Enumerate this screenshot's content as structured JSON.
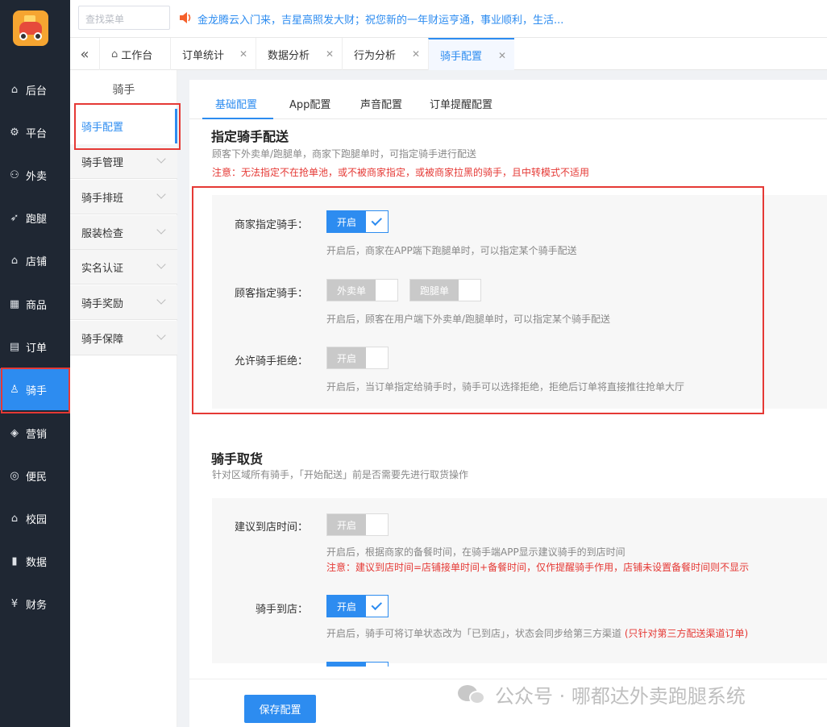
{
  "leftnav": {
    "items": [
      {
        "label": "后台",
        "icon": "⌂"
      },
      {
        "label": "平台",
        "icon": "⚙"
      },
      {
        "label": "外卖",
        "icon": "⚇"
      },
      {
        "label": "跑腿",
        "icon": "➶"
      },
      {
        "label": "店铺",
        "icon": "⌂"
      },
      {
        "label": "商品",
        "icon": "▦"
      },
      {
        "label": "订单",
        "icon": "▤"
      },
      {
        "label": "骑手",
        "icon": "♙"
      },
      {
        "label": "营销",
        "icon": "◈"
      },
      {
        "label": "便民",
        "icon": "◎"
      },
      {
        "label": "校园",
        "icon": "⌂"
      },
      {
        "label": "数据",
        "icon": "▮"
      },
      {
        "label": "财务",
        "icon": "¥"
      }
    ]
  },
  "topbar": {
    "search_placeholder": "查找菜单",
    "notice": "金龙腾云入门来，吉星高照发大财；祝您新的一年财运亨通，事业顺利，生活..."
  },
  "tabs": {
    "items": [
      {
        "label": "工作台"
      },
      {
        "label": "订单统计"
      },
      {
        "label": "数据分析"
      },
      {
        "label": "行为分析"
      },
      {
        "label": "骑手配置"
      }
    ]
  },
  "subside": {
    "title": "骑手",
    "items": [
      {
        "label": "骑手配置"
      },
      {
        "label": "骑手管理"
      },
      {
        "label": "骑手排班"
      },
      {
        "label": "服装检查"
      },
      {
        "label": "实名认证"
      },
      {
        "label": "骑手奖励"
      },
      {
        "label": "骑手保障"
      }
    ]
  },
  "content_tabs": [
    "基础配置",
    "App配置",
    "声音配置",
    "订单提醒配置"
  ],
  "section1": {
    "title": "指定骑手配送",
    "desc": "顾客下外卖单/跑腿单，商家下跑腿单时，可指定骑手进行配送",
    "warn": "注意：无法指定不在抢单池，或不被商家指定，或被商家拉黑的骑手，且中转模式不适用",
    "rows": [
      {
        "label": "商家指定骑手：",
        "toggle_label": "开启",
        "hint": "开启后，商家在APP端下跑腿单时，可以指定某个骑手配送"
      },
      {
        "label": "顾客指定骑手：",
        "toggle1_label": "外卖单",
        "toggle2_label": "跑腿单",
        "hint": "开启后，顾客在用户端下外卖单/跑腿单时，可以指定某个骑手配送"
      },
      {
        "label": "允许骑手拒绝：",
        "toggle_label": "开启",
        "hint": "开启后，当订单指定给骑手时，骑手可以选择拒绝，拒绝后订单将直接推往抢单大厅"
      }
    ]
  },
  "section2": {
    "title": "骑手取货",
    "desc": "针对区域所有骑手，「开始配送」前是否需要先进行取货操作",
    "rows": [
      {
        "label": "建议到店时间：",
        "toggle_label": "开启",
        "hint": "开启后，根据商家的备餐时间，在骑手端APP显示建议骑手的到店时间",
        "warn": "注意：建议到店时间=店铺接单时间+备餐时间，仅作提醒骑手作用，店铺未设置备餐时间则不显示"
      },
      {
        "label": "骑手到店：",
        "toggle_label": "开启",
        "hint": "开启后，骑手可将订单状态改为「已到店」，状态会同步给第三方渠道",
        "hint_red": "(只针对第三方配送渠道订单)"
      }
    ]
  },
  "save_label": "保存配置",
  "watermark": "公众号 · 哪都达外卖跑腿系统",
  "colors": {
    "accent": "#2d8cf0",
    "nav_bg": "#1f2733",
    "warn": "#e53935"
  }
}
